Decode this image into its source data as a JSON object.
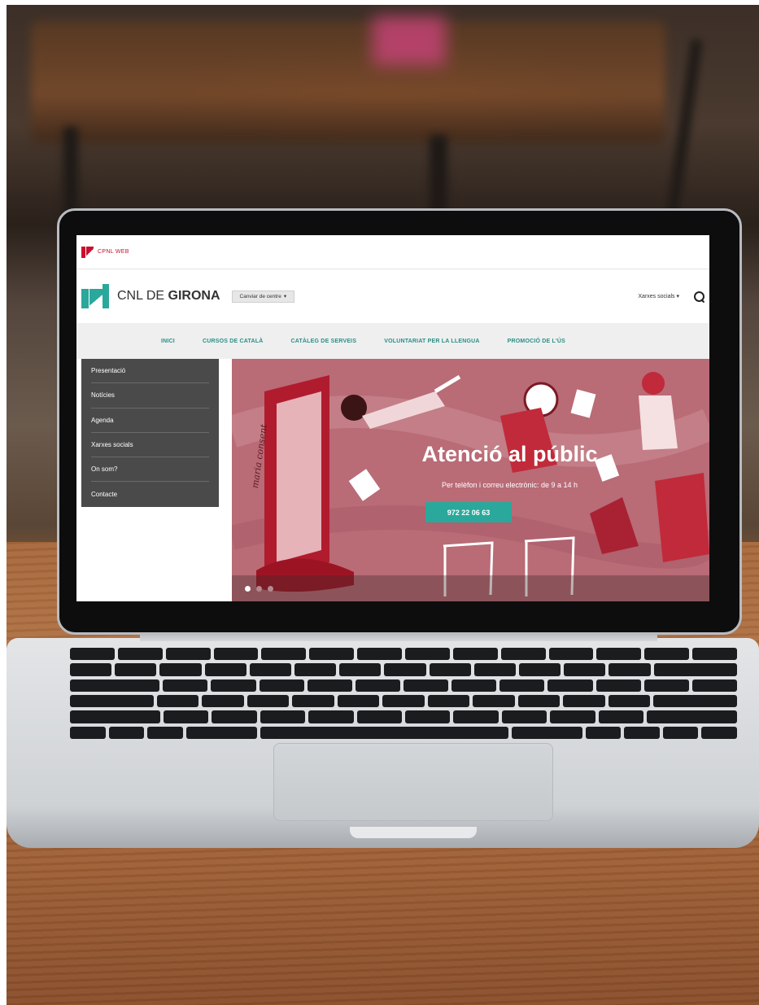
{
  "site": {
    "topbar_label": "CPNL WEB",
    "brand_prefix": "CNL DE ",
    "brand_name": "GIRONA",
    "centre_button": "Canviar de centre",
    "social_dropdown": "Xarxes socials"
  },
  "nav": {
    "items": [
      "INICI",
      "CURSOS DE CATALÀ",
      "CATÀLEG DE SERVEIS",
      "VOLUNTARIAT PER LA LLENGUA",
      "PROMOCIÓ DE L'ÚS"
    ]
  },
  "sidebar": {
    "items": [
      "Presentació",
      "Notícies",
      "Agenda",
      "Xarxes socials",
      "On som?",
      "Contacte"
    ]
  },
  "hero": {
    "title": "Atenció al públic",
    "subtitle": "Per telèfon i correu electrònic: de 9 a 14 h",
    "button": "972 22 06 63",
    "signature": "maria consent"
  },
  "icons": {
    "search": "search-icon",
    "dropdown": "chevron-down-icon",
    "logo": "cnl-logo-icon"
  },
  "colors": {
    "brand_teal": "#2aa89b",
    "cpnl_red": "#c8102e",
    "sidebar_bg": "#4a4a4a",
    "hero_bg": "#b96b76"
  }
}
